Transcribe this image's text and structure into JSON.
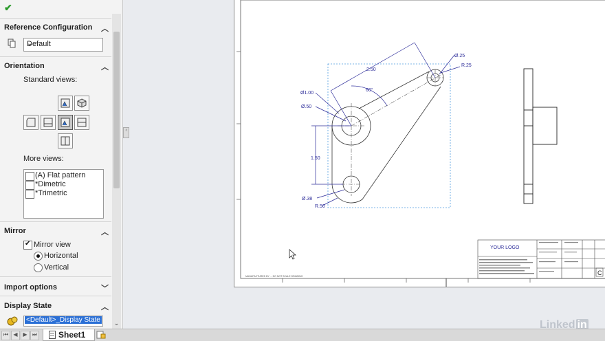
{
  "property_manager": {
    "ok_icon": "checkmark-icon",
    "reference_configuration": {
      "title": "Reference Configuration",
      "value": "Default"
    },
    "orientation": {
      "title": "Orientation",
      "standard_views_label": "Standard views:",
      "more_views_label": "More views:",
      "more_views": [
        {
          "label": "(A) Flat pattern",
          "checked": false
        },
        {
          "label": "*Dimetric",
          "checked": false
        },
        {
          "label": "*Trimetric",
          "checked": false
        }
      ]
    },
    "mirror": {
      "title": "Mirror",
      "mirror_view_label": "Mirror view",
      "horizontal_label": "Horizontal",
      "vertical_label": "Vertical"
    },
    "import_options": {
      "title": "Import options"
    },
    "display_state": {
      "title": "Display State",
      "value": "<Default>_Display State"
    }
  },
  "tabs": {
    "sheet": "Sheet1"
  },
  "drawing": {
    "dims": {
      "d250": "2.50",
      "d60": "60°",
      "dia100": "Ø1.00",
      "dia50": "Ø.50",
      "dia25": "Ø.25",
      "r25": "R.25",
      "d150": "1.50",
      "dia38": "Ø.38",
      "r50": "R.50"
    },
    "title_block": {
      "logo": "YOUR LOGO",
      "size": "C"
    },
    "footer_note": "MANUFACTURED BY ... DO NOT SCALE DRAWING"
  },
  "watermark": {
    "text": "Linked",
    "suffix": "in"
  }
}
